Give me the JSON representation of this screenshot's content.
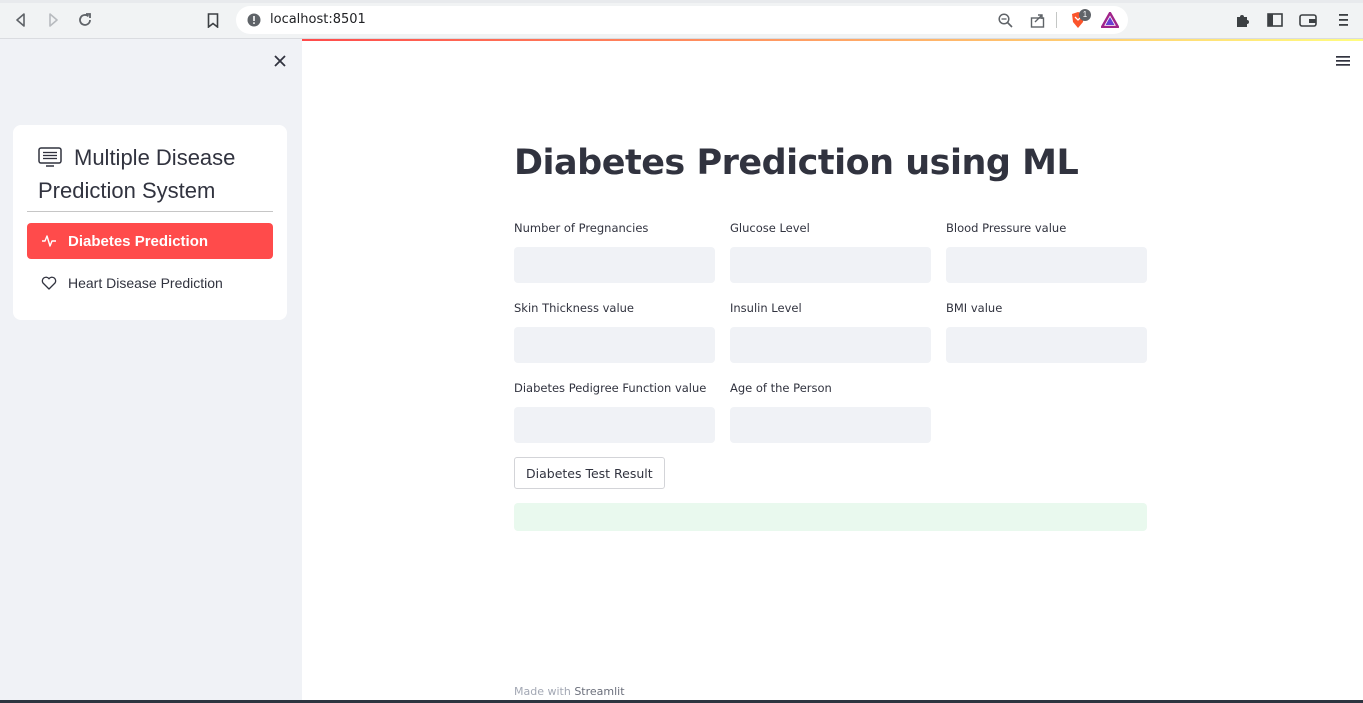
{
  "browser": {
    "url": "localhost:8501",
    "brave_badge_count": "1"
  },
  "sidebar": {
    "menu_title": "Multiple Disease Prediction System",
    "items": [
      {
        "label": "Diabetes Prediction",
        "icon": "activity-icon",
        "active": true
      },
      {
        "label": "Heart Disease Prediction",
        "icon": "heart-icon",
        "active": false
      }
    ]
  },
  "main": {
    "title": "Diabetes Prediction using ML",
    "fields": [
      {
        "label": "Number of Pregnancies",
        "value": ""
      },
      {
        "label": "Glucose Level",
        "value": ""
      },
      {
        "label": "Blood Pressure value",
        "value": ""
      },
      {
        "label": "Skin Thickness value",
        "value": ""
      },
      {
        "label": "Insulin Level",
        "value": ""
      },
      {
        "label": "BMI value",
        "value": ""
      },
      {
        "label": "Diabetes Pedigree Function value",
        "value": ""
      },
      {
        "label": "Age of the Person",
        "value": ""
      }
    ],
    "result_button": "Diabetes Test Result",
    "result_text": ""
  },
  "footer": {
    "prefix": "Made with",
    "brand": "Streamlit"
  },
  "colors": {
    "accent": "#ff4b4b",
    "sidebar_bg": "#f0f2f6",
    "success_bg": "#e9f9ee"
  }
}
